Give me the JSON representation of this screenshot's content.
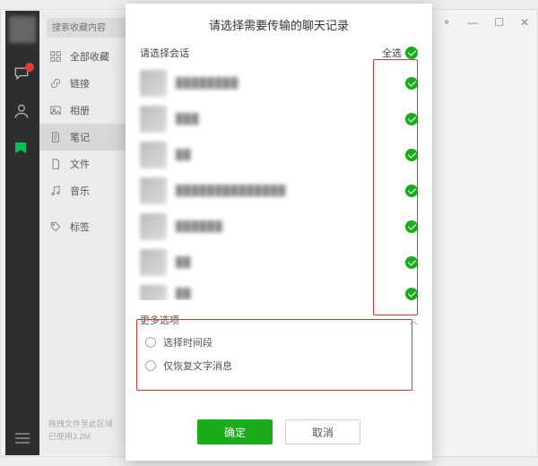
{
  "window": {
    "pin": "⚬",
    "min": "—",
    "max": "☐",
    "close": "✕"
  },
  "leftbar": {
    "badge_count": 1
  },
  "sidepanel": {
    "search_placeholder": "搜索收藏内容",
    "cats": [
      {
        "label": "全部收藏"
      },
      {
        "label": "链接"
      },
      {
        "label": "相册"
      },
      {
        "label": "笔记"
      },
      {
        "label": "文件"
      },
      {
        "label": "音乐"
      },
      {
        "label": "标签"
      }
    ],
    "footer_line1": "拖拽文件至此区域",
    "footer_line2": "已使用3.2M"
  },
  "modal": {
    "title": "请选择需要传输的聊天记录",
    "select_label": "请选择会话",
    "select_all": "全选",
    "conversations": [
      {
        "blurred_name": "████████"
      },
      {
        "blurred_name": "███"
      },
      {
        "blurred_name": "██"
      },
      {
        "blurred_name": "██████████████"
      },
      {
        "blurred_name": "██████"
      },
      {
        "blurred_name": "██"
      },
      {
        "blurred_name": "██"
      }
    ],
    "more_label": "更多选项",
    "opt_time": "选择时间段",
    "opt_text_only": "仅恢复文字消息",
    "ok": "确定",
    "cancel": "取消"
  }
}
